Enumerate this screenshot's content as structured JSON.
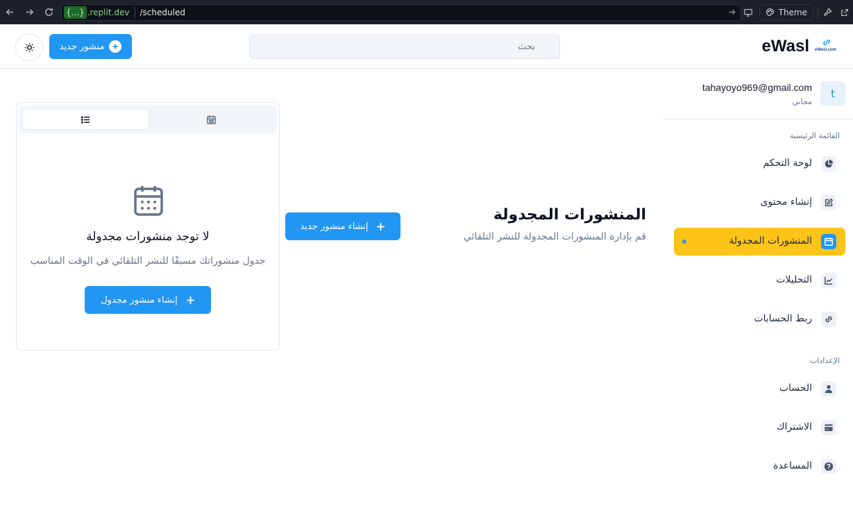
{
  "browser": {
    "url_badge": "{...}",
    "url_domain": ".replit.dev",
    "url_path": "/scheduled",
    "theme_label": "Theme"
  },
  "header": {
    "logo_text": "eWasl",
    "logo_sub": "eWasl.com",
    "search_placeholder": "بحث",
    "new_post_label": "منشور جديد"
  },
  "sidebar": {
    "user_initial": "t",
    "user_email": "tahayoyo969@gmail.com",
    "user_plan": "مجاني",
    "main_section_label": "القائمة الرئيسية",
    "settings_section_label": "الإعدادات",
    "main_items": [
      {
        "label": "لوحة التحكم",
        "icon": "pie-chart-icon"
      },
      {
        "label": "إنشاء محتوى",
        "icon": "edit-icon"
      },
      {
        "label": "المنشورات المجدولة",
        "icon": "calendar-icon",
        "active": true
      },
      {
        "label": "التحليلات",
        "icon": "trend-chart-icon"
      },
      {
        "label": "ربط الحسابات",
        "icon": "link-icon"
      }
    ],
    "settings_items": [
      {
        "label": "الحساب",
        "icon": "user-icon"
      },
      {
        "label": "الاشتراك",
        "icon": "credit-card-icon"
      },
      {
        "label": "المساعدة",
        "icon": "help-icon"
      }
    ]
  },
  "main": {
    "title": "المنشورات المجدولة",
    "subtitle": "قم بإدارة المنشورات المجدولة للنشر التلقائي",
    "create_button": "إنشاء منشور جديد",
    "empty_title": "لا توجد منشورات مجدولة",
    "empty_desc": "جدول منشوراتك مسبقًا للنشر التلقائي في الوقت المناسب",
    "empty_button": "إنشاء منشور مجدول"
  },
  "colors": {
    "primary": "#2196f3",
    "active_nav": "#fcc419"
  }
}
